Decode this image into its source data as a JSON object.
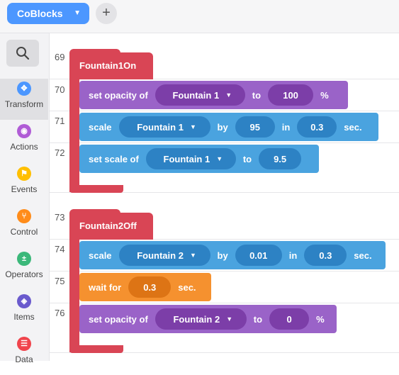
{
  "topbar": {
    "project_name": "CoBlocks",
    "add_label": "+"
  },
  "sidebar": {
    "search_icon": "search-icon",
    "categories": [
      {
        "label": "Transform",
        "color": "#4c97ff",
        "icon": "move-icon",
        "glyph": "✥",
        "active": true
      },
      {
        "label": "Actions",
        "color": "#b05cd6",
        "icon": "eye-icon",
        "glyph": "◉",
        "active": false
      },
      {
        "label": "Events",
        "color": "#ffbf00",
        "icon": "flag-icon",
        "glyph": "⚑",
        "active": false
      },
      {
        "label": "Control",
        "color": "#ff8c1a",
        "icon": "branch-icon",
        "glyph": "⑂",
        "active": false
      },
      {
        "label": "Operators",
        "color": "#3bb87a",
        "icon": "plus-minus-icon",
        "glyph": "±",
        "active": false
      },
      {
        "label": "Items",
        "color": "#6a5acd",
        "icon": "cube-icon",
        "glyph": "◈",
        "active": false
      },
      {
        "label": "Data",
        "color": "#f0444c",
        "icon": "database-icon",
        "glyph": "☰",
        "active": false
      }
    ]
  },
  "workspace": {
    "line_numbers": [
      "69",
      "70",
      "71",
      "72",
      "73",
      "74",
      "75",
      "76"
    ],
    "events": [
      {
        "name": "Fountain1On",
        "blocks": [
          {
            "kind": "opacity",
            "label": "set opacity of",
            "object": "Fountain 1",
            "to": "to",
            "value": "100",
            "unit": "%"
          },
          {
            "kind": "scale",
            "label": "scale",
            "object": "Fountain 1",
            "by": "by",
            "value": "95",
            "in": "in",
            "time": "0.3",
            "unit": "sec."
          },
          {
            "kind": "setscale",
            "label": "set scale of",
            "object": "Fountain 1",
            "to": "to",
            "value": "9.5"
          }
        ]
      },
      {
        "name": "Fountain2Off",
        "blocks": [
          {
            "kind": "scale",
            "label": "scale",
            "object": "Fountain 2",
            "by": "by",
            "value": "0.01",
            "in": "in",
            "time": "0.3",
            "unit": "sec."
          },
          {
            "kind": "wait",
            "label": "wait for",
            "value": "0.3",
            "unit": "sec."
          },
          {
            "kind": "opacity",
            "label": "set opacity of",
            "object": "Fountain 2",
            "to": "to",
            "value": "0",
            "unit": "%"
          }
        ]
      }
    ]
  },
  "colors": {
    "event": "#d94555",
    "transform_block": "#9a63c8",
    "action_block": "#4aa3df",
    "control_block": "#f5912f"
  }
}
